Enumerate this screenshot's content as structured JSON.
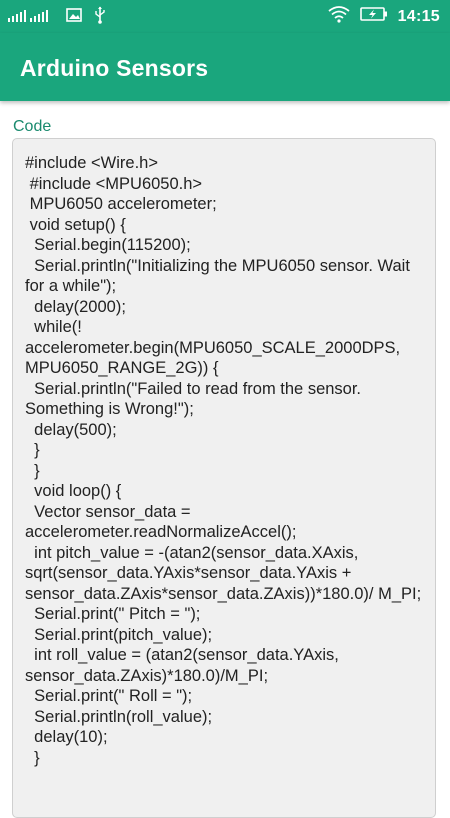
{
  "status_bar": {
    "time": "14:15",
    "icons": [
      "signal-icon",
      "image-icon",
      "usb-icon",
      "wifi-icon",
      "battery-charging-icon"
    ]
  },
  "app_bar": {
    "title": "Arduino Sensors"
  },
  "colors": {
    "primary": "#1aa67d",
    "label": "#1a8a6e",
    "code_bg": "#f0f0f0"
  },
  "code_section": {
    "label": "Code",
    "code": "#include <Wire.h>\n #include <MPU6050.h>\n MPU6050 accelerometer;\n void setup() {\n  Serial.begin(115200);\n  Serial.println(\"Initializing the MPU6050 sensor. Wait for a while\");\n  delay(2000);\n  while(! accelerometer.begin(MPU6050_SCALE_2000DPS, MPU6050_RANGE_2G)) {\n  Serial.println(\"Failed to read from the sensor. Something is Wrong!\");\n  delay(500);\n  }\n  }\n  void loop() {\n  Vector sensor_data = accelerometer.readNormalizeAccel();\n  int pitch_value = -(atan2(sensor_data.XAxis, sqrt(sensor_data.YAxis*sensor_data.YAxis + sensor_data.ZAxis*sensor_data.ZAxis))*180.0)/ M_PI;\n  Serial.print(\" Pitch = \");\n  Serial.print(pitch_value);\n  int roll_value = (atan2(sensor_data.YAxis, sensor_data.ZAxis)*180.0)/M_PI;\n  Serial.print(\" Roll = \");\n  Serial.println(roll_value);\n  delay(10);\n  }"
  }
}
